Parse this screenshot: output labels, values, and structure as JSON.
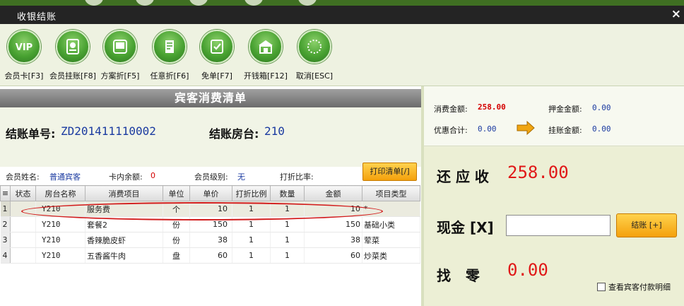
{
  "window": {
    "title": "收银结账",
    "close_glyph": "×"
  },
  "toolbar": [
    {
      "label": "会员卡[F3]",
      "icon": "vip-card-icon"
    },
    {
      "label": "会员挂账[F8]",
      "icon": "member-credit-icon"
    },
    {
      "label": "方案折[F5]",
      "icon": "scheme-discount-icon"
    },
    {
      "label": "任意折[F6]",
      "icon": "custom-discount-icon"
    },
    {
      "label": "免单[F7]",
      "icon": "free-order-icon"
    },
    {
      "label": "开钱箱[F12]",
      "icon": "cash-drawer-icon"
    },
    {
      "label": "取消[ESC]",
      "icon": "cancel-icon"
    }
  ],
  "list": {
    "title": "宾客消费清单",
    "bill_no_label": "结账单号:",
    "bill_no": "ZD201411110002",
    "room_label": "结账房台:",
    "room": "210",
    "member_name_label": "会员姓名:",
    "member_name": "普通宾客",
    "card_balance_label": "卡内余额:",
    "card_balance": "0",
    "member_level_label": "会员级别:",
    "member_level": "无",
    "discount_rate_label": "打折比率:",
    "discount_rate": "",
    "print_button": "打印清单[/]"
  },
  "table": {
    "corner_glyph": "≡",
    "columns": [
      "状态",
      "房台名称",
      "消费项目",
      "单位",
      "单价",
      "打折比例",
      "数量",
      "金额",
      "项目类型"
    ],
    "rows": [
      {
        "n": "1",
        "status": "",
        "room": "Y210",
        "item": "服务费",
        "unit": "个",
        "price": "10",
        "discount": "1",
        "qty": "1",
        "amount": "10",
        "type": "*"
      },
      {
        "n": "2",
        "status": "",
        "room": "Y210",
        "item": "套餐2",
        "unit": "份",
        "price": "150",
        "discount": "1",
        "qty": "1",
        "amount": "150",
        "type": "基础小类"
      },
      {
        "n": "3",
        "status": "",
        "room": "Y210",
        "item": "香辣脆皮虾",
        "unit": "份",
        "price": "38",
        "discount": "1",
        "qty": "1",
        "amount": "38",
        "type": "荤菜"
      },
      {
        "n": "4",
        "status": "",
        "room": "Y210",
        "item": "五香酱牛肉",
        "unit": "盘",
        "price": "60",
        "discount": "1",
        "qty": "1",
        "amount": "60",
        "type": "炒菜类"
      }
    ]
  },
  "summary": {
    "consume_label": "消费金额:",
    "consume": "258.00",
    "deposit_label": "押金金额:",
    "deposit": "0.00",
    "discount_total_label": "优惠合计:",
    "discount_total": "0.00",
    "credit_label": "挂账金额:",
    "credit": "0.00"
  },
  "pay": {
    "due_label": "还 应 收",
    "due": "258.00",
    "cash_label": "现金 [X]",
    "cash_value": "",
    "checkout_button": "结账 [+]",
    "change_label": "找   零",
    "change": "0.00",
    "detail_checkbox": "查看宾客付款明细"
  },
  "colors": {
    "accent_red": "#e01818",
    "link_blue": "#1a3aa0",
    "button_orange": "#f4a10c",
    "icon_green": "#49a232"
  }
}
